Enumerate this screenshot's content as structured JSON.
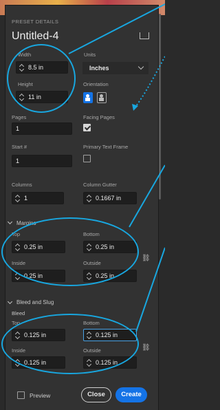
{
  "header": {
    "section_title": "PRESET DETAILS",
    "doc_name": "Untitled-4"
  },
  "fields": {
    "width": {
      "label": "Width",
      "value": "8.5 in"
    },
    "units": {
      "label": "Units",
      "value": "Inches"
    },
    "height": {
      "label": "Height",
      "value": "11 in"
    },
    "orientation": {
      "label": "Orientation"
    },
    "pages": {
      "label": "Pages",
      "value": "1"
    },
    "facing_pages": {
      "label": "Facing Pages",
      "checked": true
    },
    "start": {
      "label": "Start #",
      "value": "1"
    },
    "primary_text_frame": {
      "label": "Primary Text Frame",
      "checked": false
    },
    "columns": {
      "label": "Columns",
      "value": "1"
    },
    "column_gutter": {
      "label": "Column Gutter",
      "value": "0.1667 in"
    }
  },
  "margins": {
    "title": "Margins",
    "top": {
      "label": "Top",
      "value": "0.25 in"
    },
    "bottom": {
      "label": "Bottom",
      "value": "0.25 in"
    },
    "inside": {
      "label": "Inside",
      "value": "0.25 in"
    },
    "outside": {
      "label": "Outside",
      "value": "0.25 in"
    }
  },
  "bleed": {
    "title": "Bleed and Slug",
    "subtitle": "Bleed",
    "top": {
      "label": "Top",
      "value": "0.125 in"
    },
    "bottom": {
      "label": "Bottom",
      "value": "0.125 in"
    },
    "inside": {
      "label": "Inside",
      "value": "0.125 in"
    },
    "outside": {
      "label": "Outside",
      "value": "0.125 in"
    }
  },
  "footer": {
    "preview_label": "Preview",
    "close_label": "Close",
    "create_label": "Create"
  },
  "colors": {
    "accent": "#1473e6",
    "annotation": "#18a7e0",
    "panel": "#323232"
  }
}
